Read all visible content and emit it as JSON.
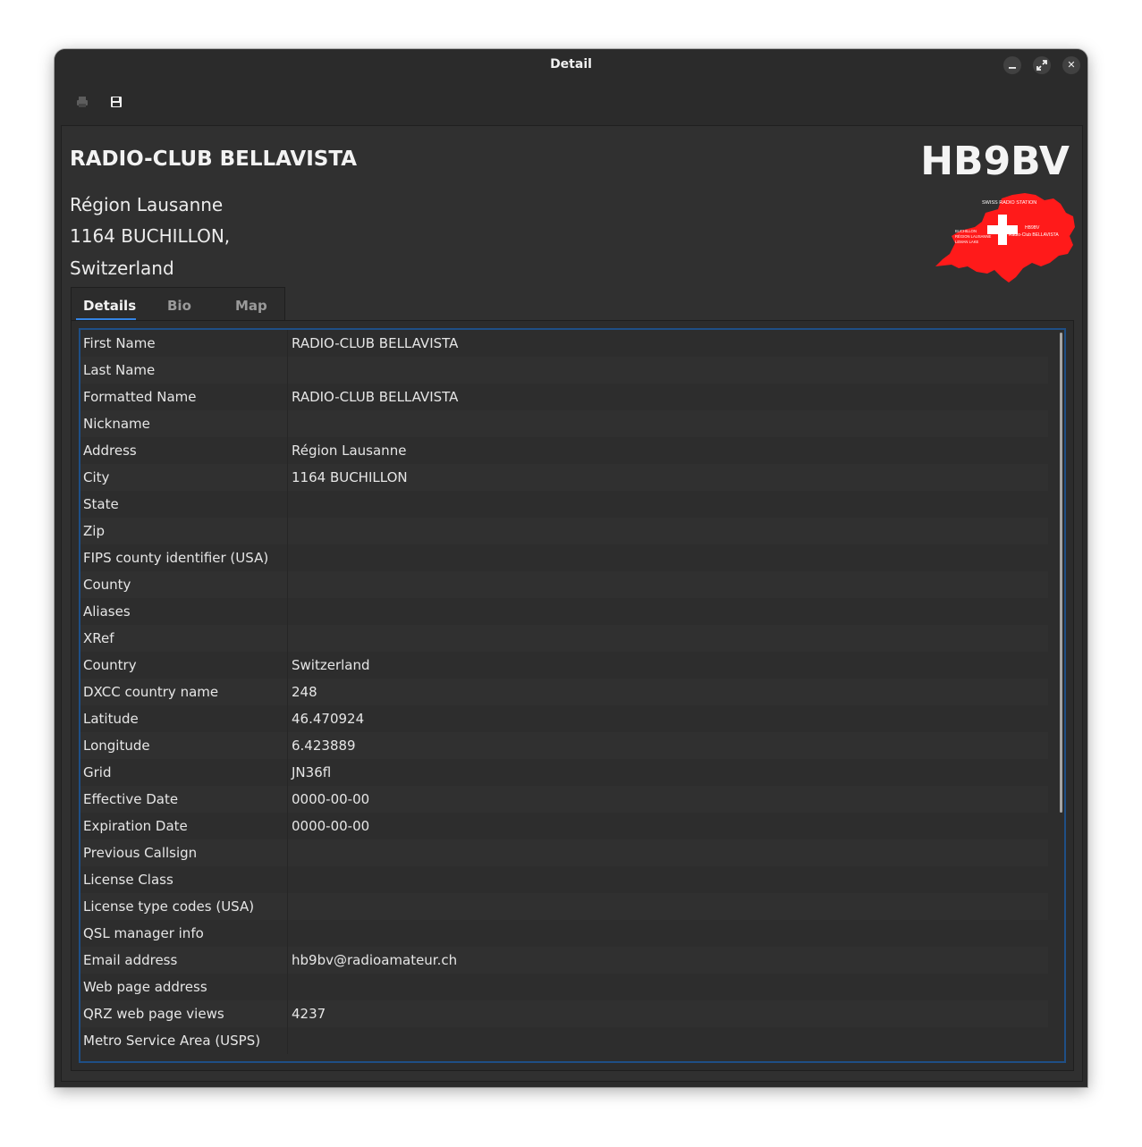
{
  "window": {
    "title": "Detail"
  },
  "window_controls": {
    "minimize_icon": "minimize-icon",
    "maximize_icon": "maximize-icon",
    "close_icon": "close-icon",
    "close_glyph": "✕"
  },
  "toolbar": {
    "print_icon": "print-icon",
    "save_icon": "save-icon"
  },
  "header": {
    "name": "RADIO-CLUB BELLAVISTA",
    "address": "Région Lausanne",
    "city": "1164 BUCHILLON,",
    "country": "Switzerland",
    "callsign": "HB9BV"
  },
  "logo": {
    "image": "swiss-map-logo",
    "color": "#ff1a1a",
    "text_top": "SWISS RADIO STATION",
    "text_call": "HB9BV",
    "text_club": "Radio-Club BELLAVISTA",
    "text_left_1": "BUCHILLON",
    "text_left_2": "RÉGION LAUSANNE",
    "text_left_3": "LEMAN LAKE"
  },
  "tabs": [
    {
      "label": "Details",
      "active": true
    },
    {
      "label": "Bio",
      "active": false
    },
    {
      "label": "Map",
      "active": false
    }
  ],
  "accent_color": "#3584e4",
  "details": [
    {
      "key": "First Name",
      "value": "RADIO-CLUB BELLAVISTA"
    },
    {
      "key": "Last Name",
      "value": ""
    },
    {
      "key": "Formatted Name",
      "value": "RADIO-CLUB BELLAVISTA"
    },
    {
      "key": "Nickname",
      "value": ""
    },
    {
      "key": "Address",
      "value": "Région Lausanne"
    },
    {
      "key": "City",
      "value": "1164 BUCHILLON"
    },
    {
      "key": "State",
      "value": ""
    },
    {
      "key": "Zip",
      "value": ""
    },
    {
      "key": "FIPS county identifier (USA)",
      "value": ""
    },
    {
      "key": "County",
      "value": ""
    },
    {
      "key": "Aliases",
      "value": ""
    },
    {
      "key": "XRef",
      "value": ""
    },
    {
      "key": "Country",
      "value": "Switzerland"
    },
    {
      "key": "DXCC country name",
      "value": "248"
    },
    {
      "key": "Latitude",
      "value": "46.470924"
    },
    {
      "key": "Longitude",
      "value": "6.423889"
    },
    {
      "key": "Grid",
      "value": "JN36fl"
    },
    {
      "key": "Effective Date",
      "value": "0000-00-00"
    },
    {
      "key": "Expiration Date",
      "value": "0000-00-00"
    },
    {
      "key": "Previous Callsign",
      "value": ""
    },
    {
      "key": "License Class",
      "value": ""
    },
    {
      "key": "License type codes (USA)",
      "value": ""
    },
    {
      "key": "QSL manager info",
      "value": ""
    },
    {
      "key": "Email address",
      "value": "hb9bv@radioamateur.ch"
    },
    {
      "key": "Web page address",
      "value": ""
    },
    {
      "key": "QRZ web page views",
      "value": "4237"
    },
    {
      "key": "Metro Service Area (USPS)",
      "value": ""
    }
  ]
}
